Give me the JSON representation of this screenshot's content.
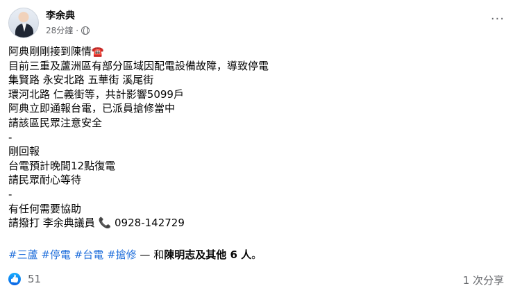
{
  "post": {
    "author": "李余典",
    "time": "28分鐘",
    "separator": "·",
    "lines": [
      "阿典剛剛接到陳情",
      "目前三重及蘆洲區有部分區域因配電設備故障，導致停電",
      "集賢路 永安北路 五華街 溪尾街",
      "環河北路 仁義街等，共計影響5099戶",
      "阿典立即通報台電，已派員搶修當中",
      "請該區民眾注意安全",
      "-",
      "剛回報",
      "台電預計晚間12點復電",
      "請民眾耐心等待",
      "-",
      "有任何需要協助",
      "請撥打 李余典議員 "
    ],
    "phone_emoji": "☎️",
    "tel_icon": "📞",
    "phone_number": "0928-142729",
    "tags": [
      "#三蘆",
      "#停電",
      "#台電",
      "#搶修"
    ],
    "with_text": " — 和",
    "with_person": "陳明志",
    "and_others": "及其他 6 人",
    "period": "。"
  },
  "footer": {
    "likes": "51",
    "shares": "1 次分享"
  },
  "icons": {
    "globe": "globe-icon",
    "more": "more-icon",
    "like": "like-icon",
    "like_color": "#1877f2",
    "link_color": "#216fdb"
  }
}
